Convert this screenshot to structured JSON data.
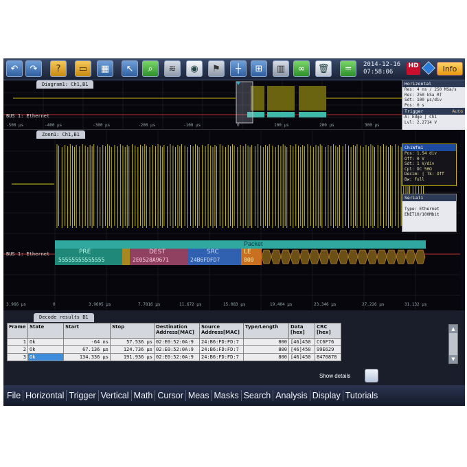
{
  "toolbar": {
    "date": "2014-12-16",
    "time": "07:58:06",
    "hd_badge": "HD",
    "info_label": "Info",
    "icons": [
      "undo-icon",
      "redo-icon",
      "help-icon",
      "open-folder-icon",
      "layout-icon",
      "pointer-icon",
      "zoom-icon",
      "fft-icon",
      "record-icon",
      "flag-icon",
      "cursor-icon",
      "measure-icon",
      "histogram-icon",
      "protocol-icon",
      "delete-icon",
      "autoset-icon"
    ]
  },
  "overview": {
    "tab_label": "Diagram1: Ch1,B1",
    "bus_label": "BUS 1: Ethernet",
    "axis_labels": [
      "-500 µs",
      "-400 µs",
      "-300 µs",
      "-200 µs",
      "-100 µs",
      "0",
      "100 µs",
      "200 µs",
      "300 µs",
      "400 µs"
    ],
    "trace_color": "#d8cc20"
  },
  "horizontal_info": {
    "title": "Horizontal",
    "lines": [
      "Res: 4 ns / 250 MSa/s",
      "Rec: 250 kSa  RT",
      "Sdt: 100 µs/div",
      "Pos: 0 s"
    ],
    "trigger_title": "Trigger",
    "trigger_mode": "Auto",
    "trigger_lines": [
      "A:    Edge  ∫  Ch1",
      "Lvl:  2.2714 V"
    ]
  },
  "zoom": {
    "tab_label": "Zoom1: Ch1,B1",
    "bus_label": "BUS 1: Ethernet",
    "packet_label": "Packet",
    "fields": [
      {
        "name": "PRE",
        "value": "55555555555555"
      },
      {
        "name": "DEST",
        "value": "2E0528A9671"
      },
      {
        "name": "SRC",
        "value": "24B6FDFD7"
      },
      {
        "name": "LE",
        "value": "800"
      }
    ],
    "axis_labels": [
      "3.966 µs",
      "0",
      "3.9605 µs",
      "7.7816 µs",
      "11.672 µs",
      "15.083 µs",
      "19.404 µs",
      "23.346 µs",
      "27.226 µs",
      "31.132 µs"
    ],
    "trace_color": "#d8cc20"
  },
  "channel_info": {
    "title": "Ch1Wfm1",
    "lines": [
      "Pos: 1.54 div",
      "Off: 0 V",
      "Sdt: 1 V/div",
      "Cpl: DC 50Ω",
      "Decim: | Tk: Off",
      "Bw: Full"
    ]
  },
  "serial_info": {
    "title": "Serial1",
    "lines": [
      "Type: Ethernet",
      "ENET10/100Mbit"
    ]
  },
  "decode": {
    "tab_label": "Decode results B1",
    "headers": [
      "Frame",
      "State",
      "Start",
      "Stop",
      "Destination Address[MAC]",
      "Source Address[MAC]",
      "Type/Length",
      "Data [hex]",
      "CRC [hex]"
    ],
    "rows": [
      [
        "1",
        "Ok",
        "-64 ns",
        "57.536 µs",
        "02:E0:52:0A:9",
        "24:B6:FD:FD:7",
        "800",
        "[46]450",
        "CC6F76"
      ],
      [
        "2",
        "Ok",
        "67.136 µs",
        "124.736 µs",
        "02:E0:52:0A:9",
        "24:B6:FD:FD:7",
        "800",
        "[46]450",
        "99E629"
      ],
      [
        "3",
        "Ok",
        "134.336 µs",
        "191.936 µs",
        "02:E0:52:0A:9",
        "24:B6:FD:FD:7",
        "800",
        "[46]450",
        "8470878"
      ]
    ],
    "selected_row": 3,
    "show_details": "Show details"
  },
  "menu": [
    "File",
    "Horizontal",
    "Trigger",
    "Vertical",
    "Math",
    "Cursor",
    "Meas",
    "Masks",
    "Search",
    "Analysis",
    "Display",
    "Tutorials"
  ]
}
